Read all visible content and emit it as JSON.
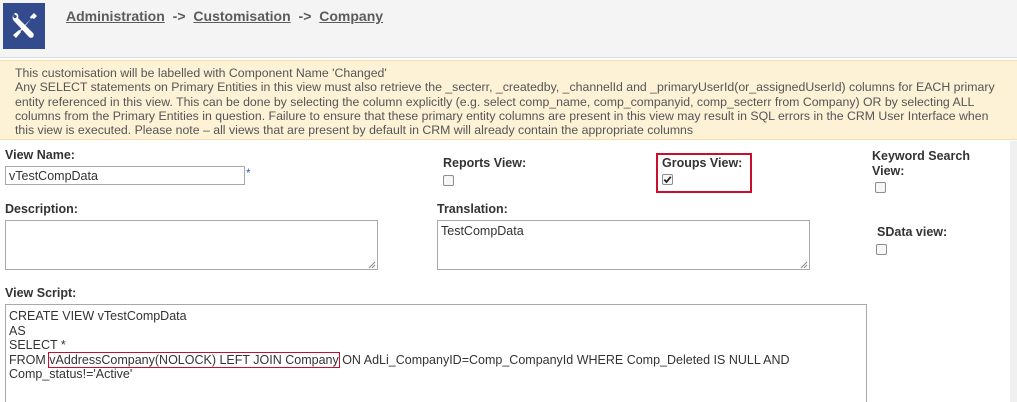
{
  "breadcrumb": {
    "items": [
      "Administration",
      "Customisation",
      "Company"
    ],
    "separator": "->"
  },
  "notice": {
    "line1": "This customisation will be labelled with Component Name 'Changed'",
    "line2": "Any SELECT statements on Primary Entities in this view must also retrieve the _secterr, _createdby, _channelId and _primaryUserId(or_assignedUserId) columns for EACH primary entity referenced in this view. This can be done by selecting the column explicitly (e.g. select comp_name, comp_companyid, comp_secterr from Company) OR by selecting ALL columns from the Primary Entities in question. Failure to ensure that these primary entity columns are present in this view may result in SQL errors in the CRM User Interface when this view is executed. Please note – all views that are present by default in CRM will already contain the appropriate columns"
  },
  "form": {
    "view_name_label": "View Name:",
    "view_name_value": "vTestCompData",
    "required_marker": "*",
    "reports_view_label": "Reports View:",
    "reports_view_checked": false,
    "groups_view_label": "Groups View:",
    "groups_view_checked": true,
    "keyword_search_label": "Keyword Search View:",
    "keyword_search_checked": false,
    "description_label": "Description:",
    "description_value": "",
    "translation_label": "Translation:",
    "translation_value": "TestCompData",
    "sdata_view_label": "SData view:",
    "sdata_view_checked": false,
    "view_script_label": "View Script:",
    "script": {
      "line1": "CREATE VIEW vTestCompData",
      "line2": "AS",
      "line3": "SELECT *",
      "line4_prefix": "FROM ",
      "line4_highlight": "vAddressCompany(NOLOCK) LEFT JOIN Company",
      "line4_suffix": " ON AdLi_CompanyID=Comp_CompanyId WHERE Comp_Deleted IS NULL AND",
      "line5": "Comp_status!='Active'"
    }
  },
  "colors": {
    "header_bg": "#f4f4f4",
    "icon_bg": "#334b8c",
    "notice_bg": "#fdf1d6",
    "highlight_red": "#c8102e"
  },
  "icons": {
    "app_icon": "tools-icon",
    "checkmark": "checkmark-icon"
  }
}
